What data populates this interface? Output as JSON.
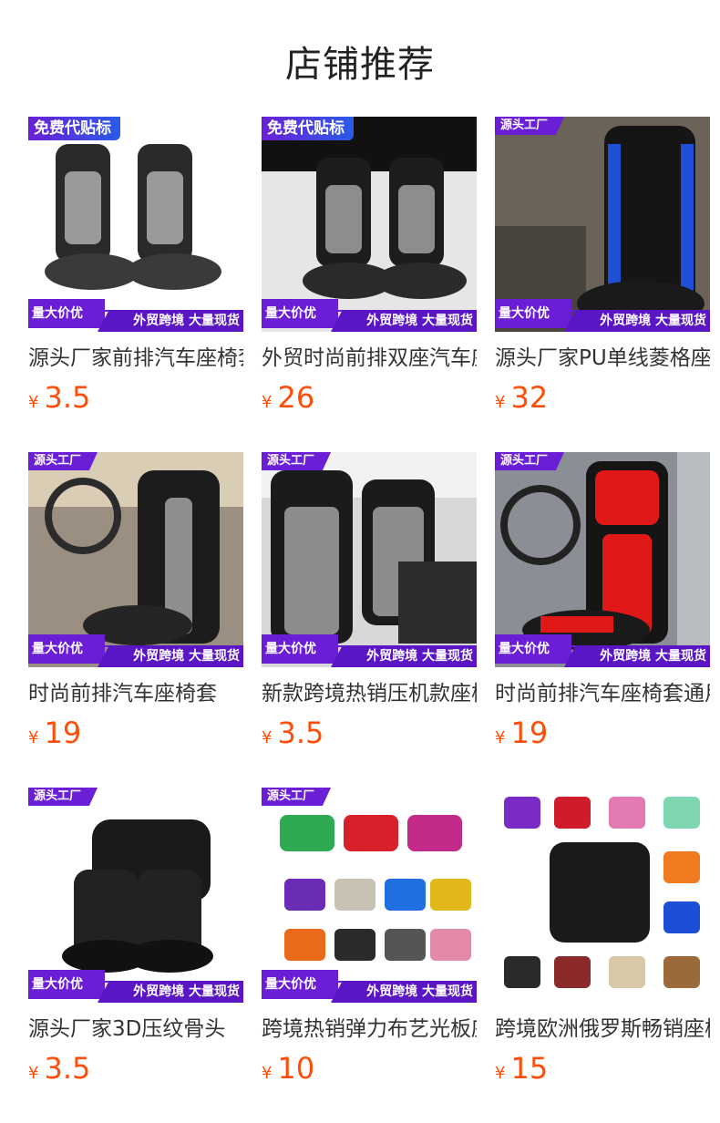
{
  "page_title": "店铺推荐",
  "colors": {
    "accent_purple": "#6a1fd6",
    "price_orange": "#ff4d0a"
  },
  "labels": {
    "free_label": "免费代贴标",
    "factory": "源头工厂",
    "bulk_discount": "量大价优",
    "crossborder_stock": "外贸跨境 大量现货",
    "currency": "¥"
  },
  "products": [
    {
      "title": "源头厂家前排汽车座椅套",
      "price": "3.5",
      "top_tag": "免费代贴标",
      "seat_color": "grey"
    },
    {
      "title": "外贸时尚前排双座汽车座椅套",
      "price": "26",
      "top_tag": "免费代贴标",
      "seat_color": "grey"
    },
    {
      "title": "源头厂家PU单线菱格座椅套",
      "price": "32",
      "top_tag": "源头工厂",
      "seat_color": "blue"
    },
    {
      "title": "时尚前排汽车座椅套",
      "price": "19",
      "top_tag": "源头工厂",
      "seat_color": "grey"
    },
    {
      "title": "新款跨境热销压机款座椅套",
      "price": "3.5",
      "top_tag": "源头工厂",
      "seat_color": "grey"
    },
    {
      "title": "时尚前排汽车座椅套通用",
      "price": "19",
      "top_tag": "源头工厂",
      "seat_color": "red"
    },
    {
      "title": "源头厂家3D压纹骨头",
      "price": "3.5",
      "top_tag": "源头工厂",
      "seat_color": "black"
    },
    {
      "title": "跨境热销弹力布艺光板座椅套",
      "price": "10",
      "top_tag": "源头工厂",
      "seat_color": "multi"
    },
    {
      "title": "跨境欧洲俄罗斯畅销座椅套",
      "price": "15",
      "top_tag": "",
      "seat_color": "multi"
    }
  ]
}
